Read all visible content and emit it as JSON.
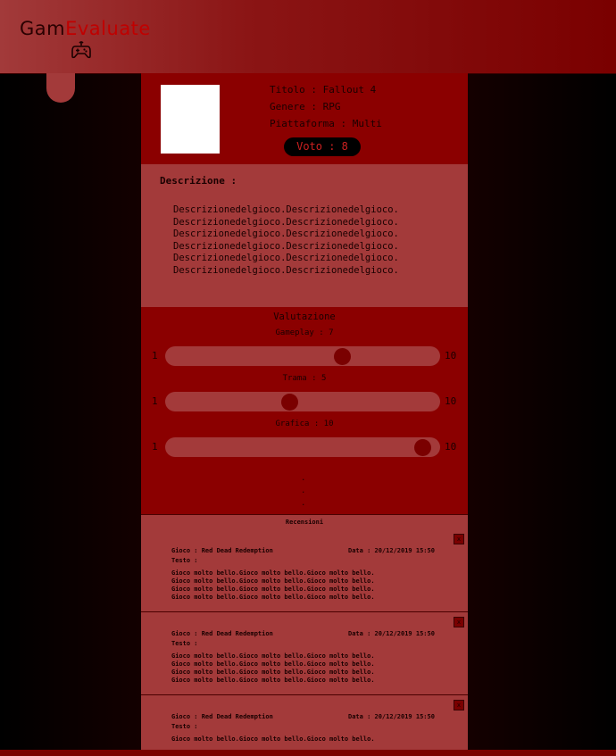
{
  "header": {
    "logo_part1": "Gam",
    "logo_part2": "Evaluate",
    "icon": "gamepad-icon"
  },
  "game": {
    "title_line": "Titolo : Fallout 4",
    "genre_line": "Genere : RPG",
    "platform_line": "Piattaforma : Multi",
    "vote_label": "Voto : 8"
  },
  "description": {
    "title": "Descrizione :",
    "text": "Descrizionedelgioco.Descrizionedelgioco.\nDescrizionedelgioco.Descrizionedelgioco.\nDescrizionedelgioco.Descrizionedelgioco.\nDescrizionedelgioco.Descrizionedelgioco.\nDescrizionedelgioco.Descrizionedelgioco.\nDescrizionedelgioco.Descrizionedelgioco."
  },
  "rating": {
    "title": "Valutazione",
    "sliders": [
      {
        "label": "Gameplay : 7",
        "min": "1",
        "max": "10",
        "value": 7
      },
      {
        "label": "Trama : 5",
        "min": "1",
        "max": "10",
        "value": 5
      },
      {
        "label": "Grafica : 10",
        "min": "1",
        "max": "10",
        "value": 10
      }
    ],
    "more": ".\n.\n."
  },
  "reviews": {
    "header": "Recensioni",
    "close_label": "x",
    "items": [
      {
        "game": "Gioco : Red Dead Redemption",
        "date": "Data : 20/12/2019 15:50",
        "testo_label": "Testo :",
        "text": "Gioco molto bello.Gioco molto bello.Gioco molto bello.\nGioco molto bello.Gioco molto bello.Gioco molto bello.\nGioco molto bello.Gioco molto bello.Gioco molto bello.\nGioco molto bello.Gioco molto bello.Gioco molto bello."
      },
      {
        "game": "Gioco : Red Dead Redemption",
        "date": "Data : 20/12/2019 15:50",
        "testo_label": "Testo :",
        "text": "Gioco molto bello.Gioco molto bello.Gioco molto bello.\nGioco molto bello.Gioco molto bello.Gioco molto bello.\nGioco molto bello.Gioco molto bello.Gioco molto bello.\nGioco molto bello.Gioco molto bello.Gioco molto bello."
      },
      {
        "game": "Gioco : Red Dead Redemption",
        "date": "Data : 20/12/2019 15:50",
        "testo_label": "Testo :",
        "text": "Gioco molto bello.Gioco molto bello.Gioco molto bello."
      }
    ]
  },
  "colors": {
    "brand_dark": "#2a0000",
    "brand_accent": "#c00000",
    "panel_dark": "#8b0000",
    "panel_light": "#a33a3a"
  }
}
